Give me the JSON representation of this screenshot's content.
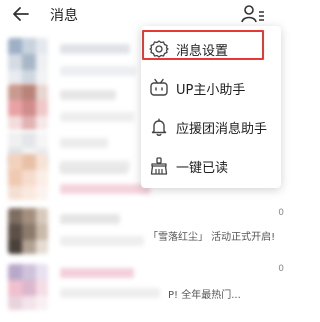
{
  "header": {
    "title": "消息",
    "back_icon": "arrow-left-icon",
    "contacts_icon": "contacts-icon"
  },
  "menu": {
    "items": [
      {
        "label": "消息设置",
        "icon": "gear-icon"
      },
      {
        "label": "UP主小助手",
        "icon": "tv-icon"
      },
      {
        "label": "应援团消息助手",
        "icon": "bell-icon"
      },
      {
        "label": "一键已读",
        "icon": "broom-icon"
      }
    ],
    "highlight_color": "#e53935"
  },
  "list": {
    "rows": [
      {
        "time": "",
        "snippet": ""
      },
      {
        "time": "",
        "snippet": ""
      },
      {
        "time": "",
        "snippet": ""
      },
      {
        "time": "",
        "snippet": ""
      },
      {
        "time": "0",
        "snippet": "「雪落红尘」 活动正式开启!"
      },
      {
        "time": "0",
        "snippet": "P! 全年最热门..."
      }
    ]
  },
  "colors": {
    "accent_pink": "#f6b7c8",
    "text_gray": "#8a8a8a"
  }
}
